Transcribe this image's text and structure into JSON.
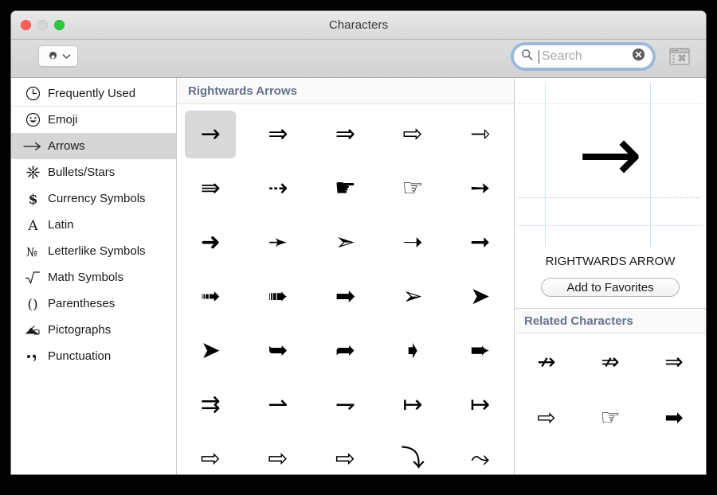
{
  "window": {
    "title": "Characters",
    "traffic_lights": [
      {
        "name": "close",
        "color": "#ff5f57"
      },
      {
        "name": "minimize",
        "color": "#d6d6d6"
      },
      {
        "name": "zoom",
        "color": "#28c840"
      }
    ]
  },
  "toolbar": {
    "gear_button": {
      "icon": "gear-icon",
      "chevron": "chevron-down-icon"
    },
    "palette_button": {
      "icon": "character-palette-icon"
    }
  },
  "search": {
    "icon": "search-icon",
    "placeholder": "Search",
    "value": "",
    "clear_icon": "clear-circle-icon",
    "focused": true,
    "focus_ring_color": "#6ea8e9"
  },
  "sidebar": {
    "items": [
      {
        "label": "Frequently Used",
        "icon": "clock-icon",
        "glyph": "◴",
        "selected": false
      },
      {
        "label": "Emoji",
        "icon": "smiley-icon",
        "glyph": "☺",
        "selected": false
      },
      {
        "label": "Arrows",
        "icon": "arrow-right-icon",
        "glyph": "⟶",
        "selected": true
      },
      {
        "label": "Bullets/Stars",
        "icon": "starburst-icon",
        "glyph": "✳",
        "selected": false
      },
      {
        "label": "Currency Symbols",
        "icon": "dollar-icon",
        "glyph": "$",
        "selected": false
      },
      {
        "label": "Latin",
        "icon": "letter-a-icon",
        "glyph": "A",
        "selected": false
      },
      {
        "label": "Letterlike Symbols",
        "icon": "numero-icon",
        "glyph": "№",
        "selected": false
      },
      {
        "label": "Math Symbols",
        "icon": "radical-icon",
        "glyph": "√",
        "selected": false
      },
      {
        "label": "Parentheses",
        "icon": "parentheses-icon",
        "glyph": "()",
        "selected": false
      },
      {
        "label": "Pictographs",
        "icon": "pictograph-icon",
        "glyph": "✍",
        "selected": false
      },
      {
        "label": "Punctuation",
        "icon": "punctuation-icon",
        "glyph": "•,",
        "selected": false
      }
    ]
  },
  "grid": {
    "section_title": "Rightwards Arrows",
    "selected_index": 0,
    "glyphs": [
      "→",
      "⇒",
      "⇒",
      "⇨",
      "⇾",
      "⇛",
      "⇢",
      "☛",
      "☞",
      "➙",
      "➜",
      "➛",
      "➣",
      "➝",
      "➞",
      "➟",
      "➠",
      "➡",
      "➢",
      "➤",
      "➤",
      "➥",
      "➦",
      "➧",
      "➨",
      "⇉",
      "⇀",
      "⇁",
      "↦",
      "↦",
      "⇨",
      "⇨",
      "⇨",
      "⤵",
      "⤳"
    ]
  },
  "preview": {
    "glyph": "→",
    "character_name": "RIGHTWARDS ARROW",
    "add_to_favorites_label": "Add to Favorites",
    "guide_color": "#cfe0f5"
  },
  "related": {
    "title": "Related Characters",
    "glyphs": [
      "↛",
      "⇏",
      "⇒",
      "⇨",
      "☞",
      "➡"
    ]
  }
}
